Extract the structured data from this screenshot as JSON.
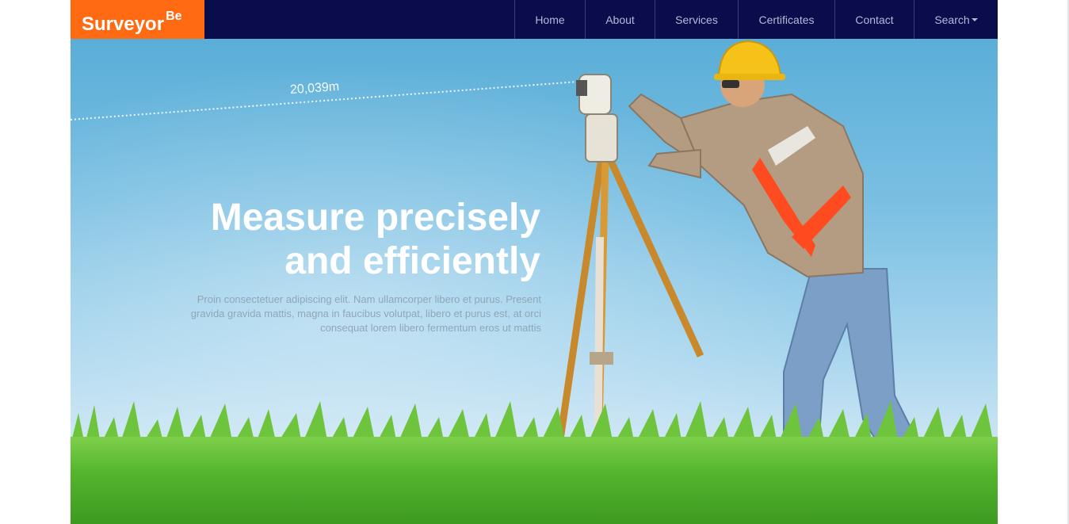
{
  "brand": {
    "name": "Surveyor",
    "sup": "Be"
  },
  "nav": {
    "home": "Home",
    "about": "About",
    "services": "Services",
    "certificates": "Certificates",
    "contact": "Contact",
    "search": "Search"
  },
  "hero": {
    "measurement": "20,039m",
    "title_line1": "Measure precisely",
    "title_line2": "and efficiently",
    "text": "Proin consectetuer adipiscing elit. Nam ullamcorper libero et purus. Present gravida gravida mattis, magna in faucibus volutpat, libero et purus est, at orci consequat lorem libero fermentum eros ut mattis"
  },
  "colors": {
    "navbar": "#0b0c4c",
    "brand_bg": "#ff6a13",
    "nav_text": "#b6b9d6"
  },
  "icons": {
    "search_dropdown": "caret-down-icon"
  }
}
